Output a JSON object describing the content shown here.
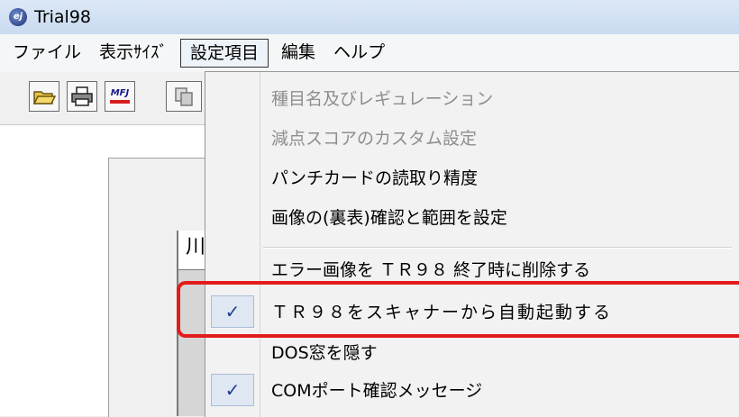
{
  "window": {
    "title": "Trial98",
    "icon": "app-logo-icon"
  },
  "menubar": {
    "items": [
      {
        "label": "ファイル"
      },
      {
        "label": "表示ｻｲｽﾞ"
      },
      {
        "label": "設定項目",
        "active": true
      },
      {
        "label": "編集"
      },
      {
        "label": "ヘルプ"
      }
    ]
  },
  "toolbar": {
    "buttons": [
      {
        "icon": "open-folder-icon"
      },
      {
        "icon": "printer-icon"
      },
      {
        "icon": "mfj-icon",
        "text": "MFJ"
      },
      {
        "icon": "copy-icon"
      }
    ]
  },
  "workspace": {
    "panel_header_text": "川"
  },
  "dropdown": {
    "items": [
      {
        "label": "種目名及びレギュレーション",
        "enabled": false,
        "checked": false
      },
      {
        "label": "減点スコアのカスタム設定",
        "enabled": false,
        "checked": false
      },
      {
        "label": "パンチカードの読取り精度",
        "enabled": true,
        "checked": false
      },
      {
        "label": "画像の(裏表)確認と範囲を設定",
        "enabled": true,
        "checked": false
      },
      {
        "label": "エラー画像を ＴＲ９８ 終了時に削除する",
        "enabled": true,
        "checked": false
      },
      {
        "label": "ＴＲ９８をスキャナーから自動起動する",
        "enabled": true,
        "checked": true,
        "highlighted": true
      },
      {
        "label": "DOS窓を隠す",
        "enabled": true,
        "checked": false
      },
      {
        "label": "COMポート確認メッセージ",
        "enabled": true,
        "checked": true
      }
    ],
    "check_glyph": "✓"
  },
  "colors": {
    "highlight": "#e41b1b",
    "check": "#1e3d8f",
    "disabled_text": "#8e8e8e"
  }
}
